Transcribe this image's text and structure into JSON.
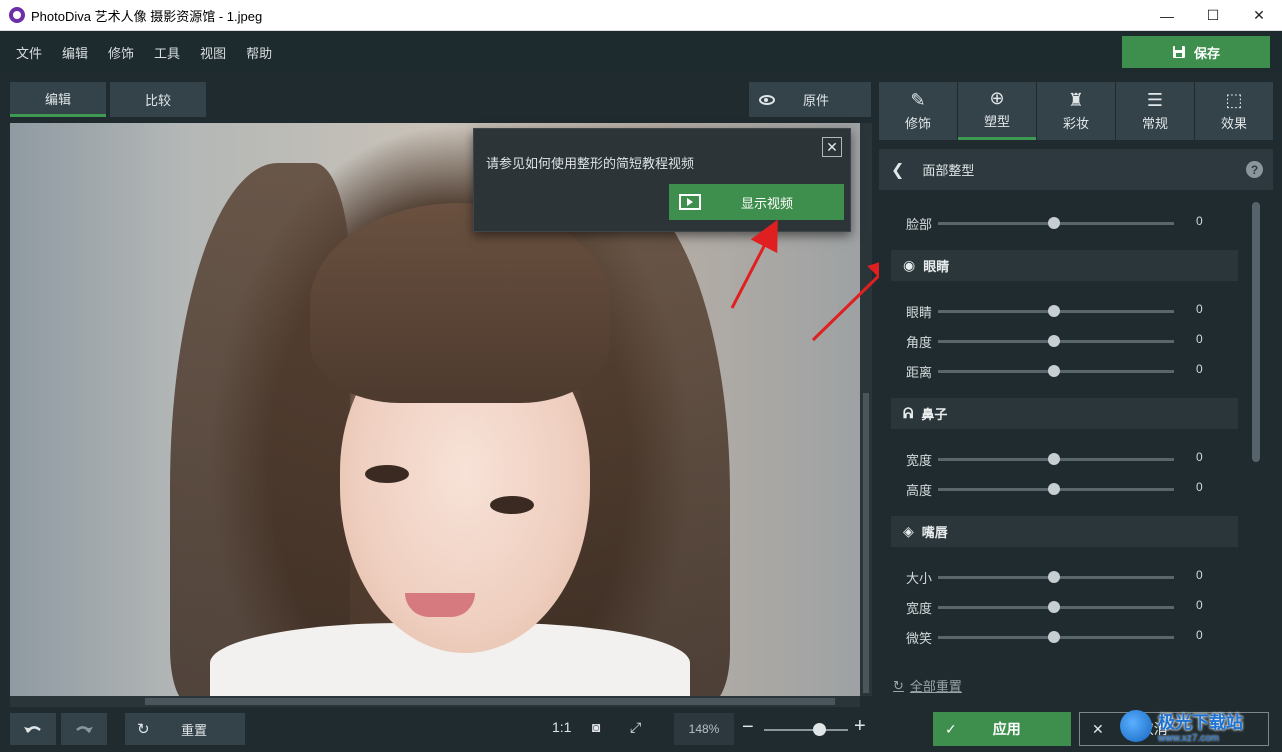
{
  "window": {
    "title": "PhotoDiva 艺术人像 摄影资源馆 - 1.jpeg",
    "minimize": "—",
    "maximize": "☐",
    "close": "✕"
  },
  "menu": [
    "文件",
    "编辑",
    "修饰",
    "工具",
    "视图",
    "帮助"
  ],
  "save_label": "保存",
  "left_tabs": {
    "edit": "编辑",
    "compare": "比较"
  },
  "original_label": "原件",
  "popup": {
    "text": "请参见如何使用整形的简短教程视频",
    "button": "显示视频"
  },
  "bottom": {
    "reset_label": "重置",
    "ratio_label": "1:1",
    "zoom_value": "148%",
    "zoom_level": 0.66
  },
  "right_tabs": [
    {
      "label": "修饰",
      "icon": "retouch-icon"
    },
    {
      "label": "塑型",
      "icon": "reshape-icon",
      "active": true
    },
    {
      "label": "彩妆",
      "icon": "makeup-icon"
    },
    {
      "label": "常规",
      "icon": "sliders-icon"
    },
    {
      "label": "效果",
      "icon": "effects-icon"
    }
  ],
  "section": {
    "title": "面部整型",
    "help": "?"
  },
  "sliders": {
    "face": {
      "label": "脸部",
      "value": "0"
    },
    "eyes_group": "眼睛",
    "eyes": [
      {
        "label": "眼睛",
        "value": "0"
      },
      {
        "label": "角度",
        "value": "0"
      },
      {
        "label": "距离",
        "value": "0"
      }
    ],
    "nose_group": "鼻子",
    "nose": [
      {
        "label": "宽度",
        "value": "0"
      },
      {
        "label": "高度",
        "value": "0"
      }
    ],
    "lips_group": "嘴唇",
    "lips": [
      {
        "label": "大小",
        "value": "0"
      },
      {
        "label": "宽度",
        "value": "0"
      },
      {
        "label": "微笑",
        "value": "0"
      }
    ]
  },
  "reset_all": "全部重置",
  "apply_label": "应用",
  "cancel_label": "取消",
  "watermark": {
    "main": "极光下载站",
    "sub": "www.xz7.com"
  },
  "colors": {
    "accent": "#3e8f4d",
    "arrow": "#e02020"
  }
}
